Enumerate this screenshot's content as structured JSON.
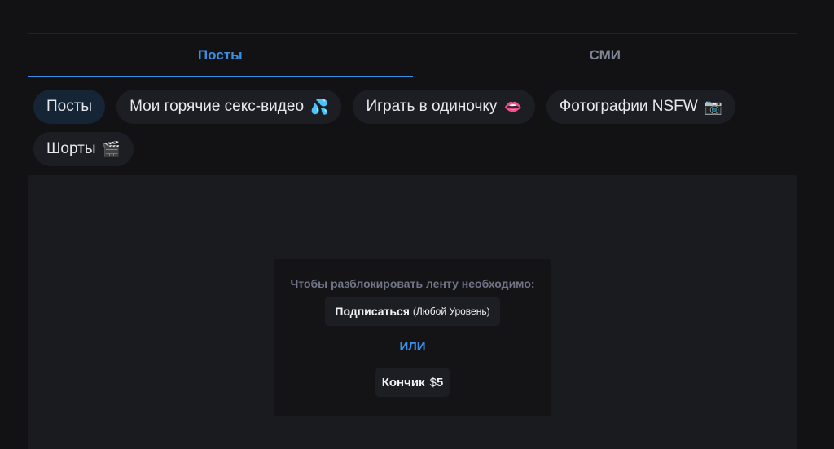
{
  "tabs": [
    {
      "label": "Посты",
      "active": true
    },
    {
      "label": "СМИ",
      "active": false
    }
  ],
  "chips": [
    {
      "label": "Посты",
      "emoji": "",
      "active": true
    },
    {
      "label": "Мои горячие секс-видео",
      "emoji": "💦",
      "active": false
    },
    {
      "label": "Играть в одиночку",
      "emoji": "👄",
      "active": false
    },
    {
      "label": "Фотографии NSFW",
      "emoji": "📷",
      "active": false
    },
    {
      "label": "Шорты",
      "emoji": "🎬",
      "active": false
    }
  ],
  "unlock": {
    "title": "Чтобы разблокировать ленту необходимо:",
    "subscribe_label": "Подписаться",
    "subscribe_level": "(Любой Уровень)",
    "or_label": "ИЛИ",
    "tip_label": "Кончик",
    "tip_currency": "$",
    "tip_amount": "5"
  },
  "colors": {
    "accent": "#3a8fe6",
    "background": "#121214",
    "panel": "#1a1b1f"
  }
}
